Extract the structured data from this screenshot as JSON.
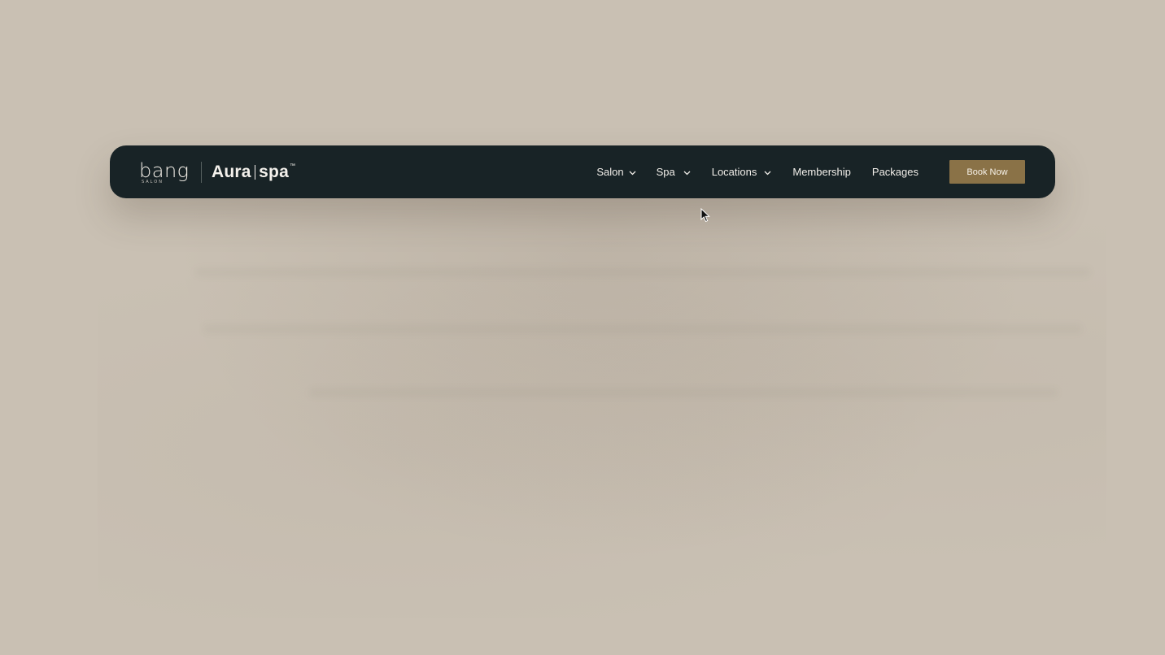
{
  "brand": {
    "bang_wordmark": "bang",
    "bang_subtitle": "SALON",
    "aura_left": "Aura",
    "aura_right": "spa",
    "trademark": "™"
  },
  "nav": {
    "items": [
      {
        "label": "Salon",
        "has_dropdown": true
      },
      {
        "label": "Spa",
        "has_dropdown": true
      },
      {
        "label": "Locations",
        "has_dropdown": true
      },
      {
        "label": "Membership",
        "has_dropdown": false
      },
      {
        "label": "Packages",
        "has_dropdown": false
      }
    ],
    "cta_label": "Book Now"
  },
  "colors": {
    "page_background": "#c9c0b3",
    "navbar_background": "#182326",
    "cta_background": "#8a7247",
    "nav_text": "#f1eee9"
  },
  "icons": {
    "dropdown": "chevron-down-icon",
    "pointer": "mouse-cursor-icon"
  }
}
